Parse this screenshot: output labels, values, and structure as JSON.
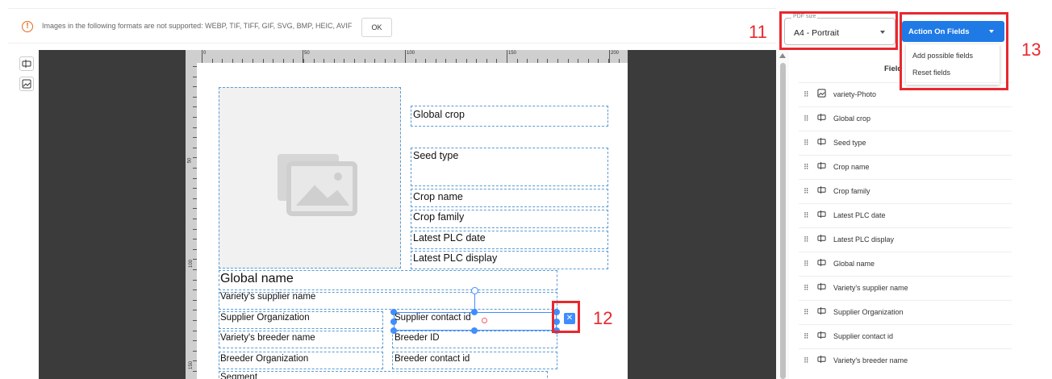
{
  "notice": {
    "message": "Images in the following formats are not supported: WEBP, TIF, TIFF, GIF, SVG, BMP, HEIC, AVIF",
    "ok_label": "OK"
  },
  "pdf_size": {
    "legend": "PDF size",
    "value": "A4 - Portrait"
  },
  "action_button": {
    "label": "Action On Fields",
    "menu": [
      "Add possible fields",
      "Reset fields"
    ]
  },
  "ruler": {
    "top_labels": [
      "0",
      "50",
      "100",
      "150",
      "200"
    ],
    "left_labels": [
      "50",
      "100",
      "150"
    ]
  },
  "canvas_fields": {
    "global_crop": "Global crop",
    "seed_type": "Seed type",
    "crop_name": "Crop name",
    "crop_family": "Crop family",
    "latest_plc_date": "Latest PLC date",
    "latest_plc_display": "Latest PLC display",
    "global_name": "Global name",
    "variety_supplier_name": "Variety's supplier name",
    "supplier_organization": "Supplier Organization",
    "supplier_contact_id": "Supplier contact id",
    "variety_breeder_name": "Variety's breeder name",
    "breeder_id": "Breeder ID",
    "breeder_organization": "Breeder Organization",
    "breeder_contact_id": "Breeder contact id",
    "segment": "Segment"
  },
  "fields_panel": {
    "heading": "Field",
    "items": [
      {
        "label": "variety-Photo",
        "icon": "image-icon"
      },
      {
        "label": "Global crop",
        "icon": "text-field-icon"
      },
      {
        "label": "Seed type",
        "icon": "text-field-icon"
      },
      {
        "label": "Crop name",
        "icon": "text-field-icon"
      },
      {
        "label": "Crop family",
        "icon": "text-field-icon"
      },
      {
        "label": "Latest PLC date",
        "icon": "text-field-icon"
      },
      {
        "label": "Latest PLC display",
        "icon": "text-field-icon"
      },
      {
        "label": "Global name",
        "icon": "text-field-icon"
      },
      {
        "label": "Variety's supplier name",
        "icon": "text-field-icon"
      },
      {
        "label": "Supplier Organization",
        "icon": "text-field-icon"
      },
      {
        "label": "Supplier contact id",
        "icon": "text-field-icon"
      },
      {
        "label": "Variety's breeder name",
        "icon": "text-field-icon"
      }
    ]
  },
  "annotations": {
    "a11": "11",
    "a12": "12",
    "a13": "13"
  },
  "colors": {
    "accent": "#1f7ae6",
    "annotation": "#e8282e",
    "selection": "#3f8dff",
    "warning": "#e46a1c"
  }
}
